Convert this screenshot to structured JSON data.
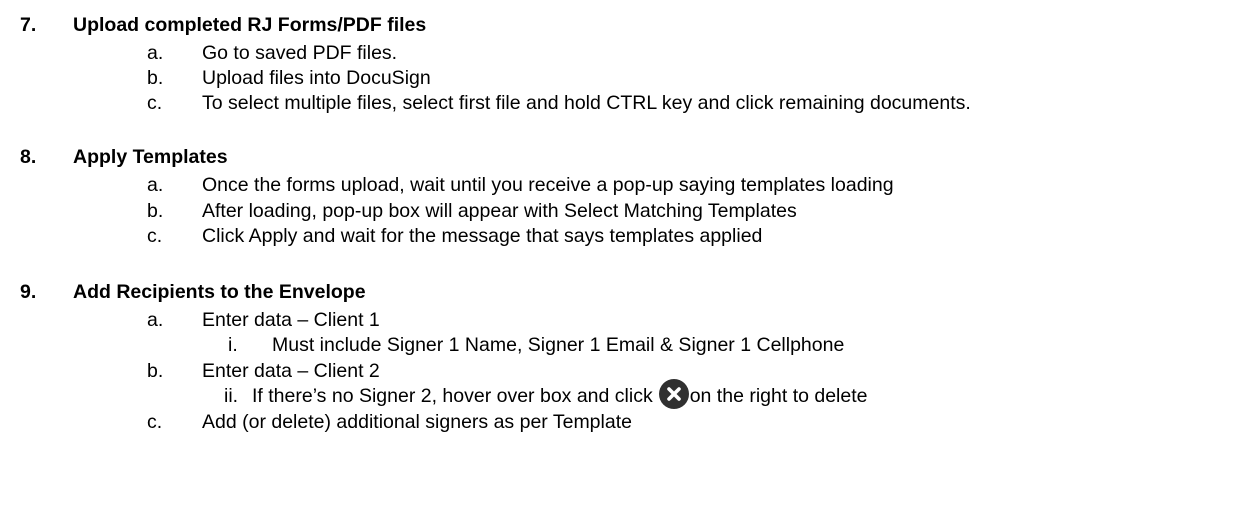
{
  "sections": [
    {
      "number": "7.",
      "title": "Upload completed RJ Forms/PDF files",
      "items": [
        {
          "marker": "a.",
          "text": "Go to saved PDF files."
        },
        {
          "marker": "b.",
          "text": "Upload files into DocuSign"
        },
        {
          "marker": "c.",
          "text": "To select multiple files, select first file and hold CTRL key and click remaining documents."
        }
      ]
    },
    {
      "number": "8.",
      "title": "Apply Templates",
      "items": [
        {
          "marker": "a.",
          "text": "Once the forms upload, wait until you receive a pop-up saying templates loading"
        },
        {
          "marker": "b.",
          "text": "After loading, pop-up box will appear with Select Matching Templates"
        },
        {
          "marker": "c.",
          "text": "Click Apply and wait for the message that says templates applied"
        }
      ]
    },
    {
      "number": "9.",
      "title": "Add Recipients to the Envelope",
      "items": [
        {
          "marker": "a.",
          "text": "Enter data – Client 1"
        },
        {
          "marker": "i.",
          "text": "Must include Signer 1 Name, Signer 1 Email & Signer 1 Cellphone"
        },
        {
          "marker": "b.",
          "text": "Enter data – Client 2"
        },
        {
          "marker": "ii.",
          "text_before": "If there’s no Signer 2, hover over box and click",
          "icon": "close-circle-icon",
          "text_after": "on the right to delete"
        },
        {
          "marker": "c.",
          "text": "Add (or delete) additional signers as per Template"
        }
      ]
    }
  ]
}
